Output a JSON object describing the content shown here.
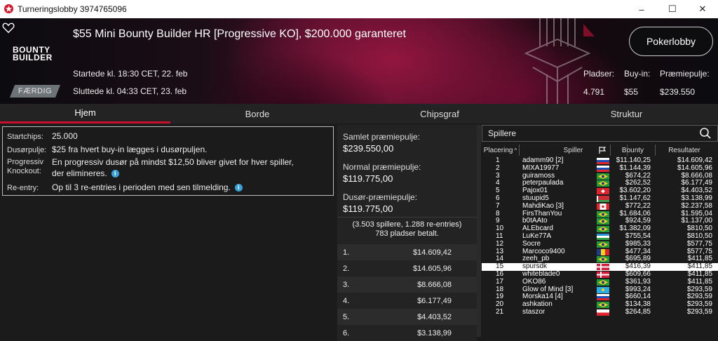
{
  "window": {
    "title": "Turneringslobby 3974765096",
    "controls": [
      "–",
      "☐",
      "✕"
    ]
  },
  "header": {
    "logo_line1": "BOUNTY",
    "logo_line2": "BUILDER",
    "title": "$55 Mini Bounty Builder HR [Progressive KO], $200.000 garanteret",
    "started": "Startede kl. 18:30 CET, 22. feb",
    "ended": "Sluttede kl. 04:33 CET, 23. feb",
    "status_badge": "FÆRDIG",
    "lobby_button": "Pokerlobby",
    "stats": {
      "players_label": "Pladser:",
      "players_value": "4.791",
      "buyin_label": "Buy-in:",
      "buyin_value": "$55",
      "prize_label": "Præmiepulje:",
      "prize_value": "$239.550"
    }
  },
  "tabs": [
    "Hjem",
    "Borde",
    "Chipsgraf",
    "Struktur"
  ],
  "info": {
    "startchips_label": "Startchips:",
    "startchips_value": "25.000",
    "bountypool_label": "Dusørpulje:",
    "bountypool_value": "$25 fra hvert buy-in lægges i dusørpuljen.",
    "pko_label_1": "Progressiv",
    "pko_label_2": "Knockout:",
    "pko_value_1": "En progressiv dusør på mindst $12,50 bliver givet for hver spiller,",
    "pko_value_2": "der elimineres.",
    "reentry_label": "Re-entry:",
    "reentry_value": "Op til 3 re-entries i perioden med sen tilmelding."
  },
  "prize": {
    "total_label": "Samlet præmiepulje:",
    "total_value": "$239.550,00",
    "normal_label": "Normal præmiepulje:",
    "normal_value": "$119.775,00",
    "bounty_label": "Dusør-præmiepulje:",
    "bounty_value": "$119.775,00",
    "note_1": "(3.503 spillere, 1.288 re-entries)",
    "note_2": "783 pladser betalt.",
    "places": [
      {
        "n": "1.",
        "v": "$14.609,42"
      },
      {
        "n": "2.",
        "v": "$14.605,96"
      },
      {
        "n": "3.",
        "v": "$8.666,08"
      },
      {
        "n": "4.",
        "v": "$6.177,49"
      },
      {
        "n": "5.",
        "v": "$4.403,52"
      },
      {
        "n": "6.",
        "v": "$3.138,99"
      }
    ]
  },
  "players": {
    "title": "Spillere",
    "columns": {
      "place": "Placering",
      "player": "Spiller",
      "bounty": "Bounty",
      "result": "Resultater"
    },
    "rows": [
      {
        "p": "1",
        "name": "adamm90 [2]",
        "flag": "SI",
        "bounty": "$11.140,25",
        "result": "$14.609,42"
      },
      {
        "p": "2",
        "name": "MIXA19977",
        "flag": "SI",
        "bounty": "$1.144,39",
        "result": "$14.605,96"
      },
      {
        "p": "3",
        "name": "guiramoss",
        "flag": "BR",
        "bounty": "$674,22",
        "result": "$8.666,08"
      },
      {
        "p": "4",
        "name": "peterpaulada",
        "flag": "BR",
        "bounty": "$262,52",
        "result": "$6.177,49"
      },
      {
        "p": "5",
        "name": "Pajox01",
        "flag": "CH",
        "bounty": "$3.602,20",
        "result": "$4.403,52"
      },
      {
        "p": "6",
        "name": "stuupid5",
        "flag": "BY",
        "bounty": "$1.147,62",
        "result": "$3.138,99"
      },
      {
        "p": "7",
        "name": "MahdiKao [3]",
        "flag": "CA",
        "bounty": "$772,22",
        "result": "$2.237,58"
      },
      {
        "p": "8",
        "name": "FirsThanYou",
        "flag": "BR",
        "bounty": "$1.684,06",
        "result": "$1.595,04"
      },
      {
        "p": "9",
        "name": "b0tAAto",
        "flag": "BR",
        "bounty": "$924,59",
        "result": "$1.137,00"
      },
      {
        "p": "10",
        "name": "ALEbcard",
        "flag": "BR",
        "bounty": "$1.382,09",
        "result": "$810,50"
      },
      {
        "p": "11",
        "name": "LuKe77A",
        "flag": "UZ",
        "bounty": "$755,54",
        "result": "$810,50"
      },
      {
        "p": "12",
        "name": "Socre",
        "flag": "BR",
        "bounty": "$985,33",
        "result": "$577,75"
      },
      {
        "p": "13",
        "name": "Marcoco9400",
        "flag": "RO",
        "bounty": "$477,34",
        "result": "$577,75"
      },
      {
        "p": "14",
        "name": "zeeh_pb",
        "flag": "BR",
        "bounty": "$695,89",
        "result": "$411,85"
      },
      {
        "p": "15",
        "name": "spursdk",
        "flag": "DK",
        "bounty": "$416,39",
        "result": "$411,85",
        "highlight": true
      },
      {
        "p": "16",
        "name": "whiteblade0",
        "flag": "DK",
        "bounty": "$609,66",
        "result": "$411,85"
      },
      {
        "p": "17",
        "name": "OKO86",
        "flag": "BR",
        "bounty": "$361,93",
        "result": "$411,85"
      },
      {
        "p": "18",
        "name": "Glow of Mind [3]",
        "flag": "KZ",
        "bounty": "$993,24",
        "result": "$293,59"
      },
      {
        "p": "19",
        "name": "Morska14 [4]",
        "flag": "SI",
        "bounty": "$660,14",
        "result": "$293,59"
      },
      {
        "p": "20",
        "name": "ashkation",
        "flag": "BR",
        "bounty": "$134,38",
        "result": "$293,59"
      },
      {
        "p": "21",
        "name": "staszor",
        "flag": "PL",
        "bounty": "$264,85",
        "result": "$293,59"
      }
    ]
  },
  "colors": {
    "accent": "#c8102e",
    "highlight_row": "#ffffff"
  }
}
